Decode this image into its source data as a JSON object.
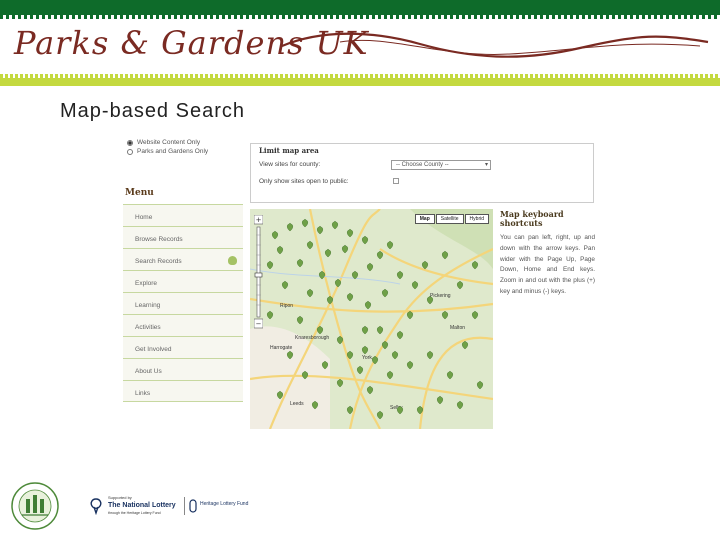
{
  "banner": {
    "logo_text": "Parks & Gardens UK",
    "colors": {
      "top_strip": "#0e6b2a",
      "bottom_strip": "#c4d93f",
      "logo": "#7a2a22"
    }
  },
  "slide": {
    "heading": "Map-based Search"
  },
  "screenshot": {
    "search_scope": {
      "options": [
        {
          "label": "Website Content Only",
          "selected": true
        },
        {
          "label": "Parks and Gardens Only",
          "selected": false
        }
      ]
    },
    "limit_map_area": {
      "title": "Limit map area",
      "county_label": "View sites for county:",
      "county_select_value": "-- Choose County --",
      "open_label": "Only show sites open to public:",
      "open_checked": false
    },
    "menu": {
      "title": "Menu",
      "items": [
        {
          "label": "Home"
        },
        {
          "label": "Browse Records"
        },
        {
          "label": "Search Records"
        },
        {
          "label": "Explore"
        },
        {
          "label": "Learning"
        },
        {
          "label": "Activities"
        },
        {
          "label": "Get Involved"
        },
        {
          "label": "About Us"
        },
        {
          "label": "Links"
        }
      ]
    },
    "map": {
      "type_buttons": [
        "Map",
        "Satellite",
        "Hybrid"
      ],
      "selected_type": "Map",
      "place_labels": [
        {
          "label": "Ripon"
        },
        {
          "label": "Harrogate"
        },
        {
          "label": "York"
        },
        {
          "label": "Leeds"
        },
        {
          "label": "Pickering"
        },
        {
          "label": "Malton"
        },
        {
          "label": "Knaresborough"
        },
        {
          "label": "Selby"
        }
      ],
      "marker_icon": "oak-leaf-icon",
      "colors": {
        "land": "#dfe9cc",
        "road": "#f4d57a",
        "marker": "#6fa047"
      }
    },
    "keyboard_shortcuts": {
      "title": "Map keyboard shortcuts",
      "body": "You can pan left, right, up and down with the arrow keys. Pan wider with the Page Up, Page Down, Home and End keys. Zoom in and out with the plus (+) key and minus (-) keys."
    }
  },
  "footer": {
    "supported_by": "Supported by",
    "lottery_name": "The National Lottery",
    "lottery_sub": "through the Heritage Lottery Fund",
    "hlf_name": "Heritage Lottery Fund"
  }
}
